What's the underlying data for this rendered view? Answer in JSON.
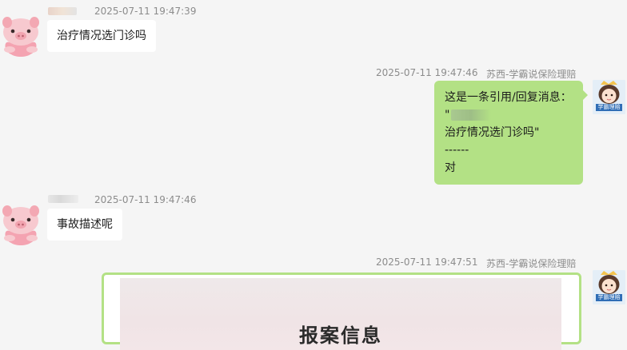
{
  "messages": [
    {
      "direction": "in",
      "timestamp": "2025-07-11 19:47:39",
      "text": "治疗情况选门诊吗"
    },
    {
      "direction": "out",
      "timestamp": "2025-07-11 19:47:46",
      "sender": "苏西-学霸说保险理赔",
      "quote_header": "这是一条引用/回复消息：",
      "quote_prefix": "\"",
      "quote_text": "治疗情况选门诊吗\"",
      "separator": "------",
      "reply": "对"
    },
    {
      "direction": "in",
      "timestamp": "2025-07-11 19:47:46",
      "text": "事故描述呢"
    },
    {
      "direction": "out",
      "timestamp": "2025-07-11 19:47:51",
      "sender": "苏西-学霸说保险理赔",
      "card_title": "报案信息"
    }
  ],
  "avatar_badge": "学霸理赔",
  "colors": {
    "out_bubble": "#b3e185",
    "in_bubble": "#ffffff",
    "background": "#f5f5f5",
    "meta_text": "#8c8c8c"
  },
  "icons": {
    "contact_avatar": "pig-avatar-icon",
    "self_avatar": "girl-avatar-icon"
  }
}
